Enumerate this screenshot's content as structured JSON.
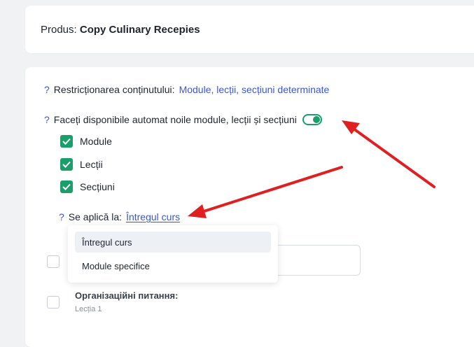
{
  "product": {
    "label": "Produs:",
    "name": "Copy Culinary Recepies"
  },
  "restriction": {
    "help": "?",
    "label": "Restricționarea conținutului:",
    "value": "Module, lecții, secțiuni determinate"
  },
  "auto_available": {
    "help": "?",
    "label": "Faceți disponibile automat noile module, lecții și secțiuni",
    "enabled": true
  },
  "options": [
    {
      "label": "Module",
      "checked": true
    },
    {
      "label": "Lecții",
      "checked": true
    },
    {
      "label": "Secțiuni",
      "checked": true
    }
  ],
  "applies_to": {
    "help": "?",
    "label": "Se aplică la:",
    "value": "Întregul curs"
  },
  "dropdown_options": [
    "Întregul curs",
    "Module specifice"
  ],
  "lesson": {
    "title": "Організаційні питання:",
    "subtitle": "Lecția 1"
  },
  "colors": {
    "accent": "#3a57d6",
    "toggle_green": "#1a9e6a",
    "arrow_red": "#e02020"
  }
}
